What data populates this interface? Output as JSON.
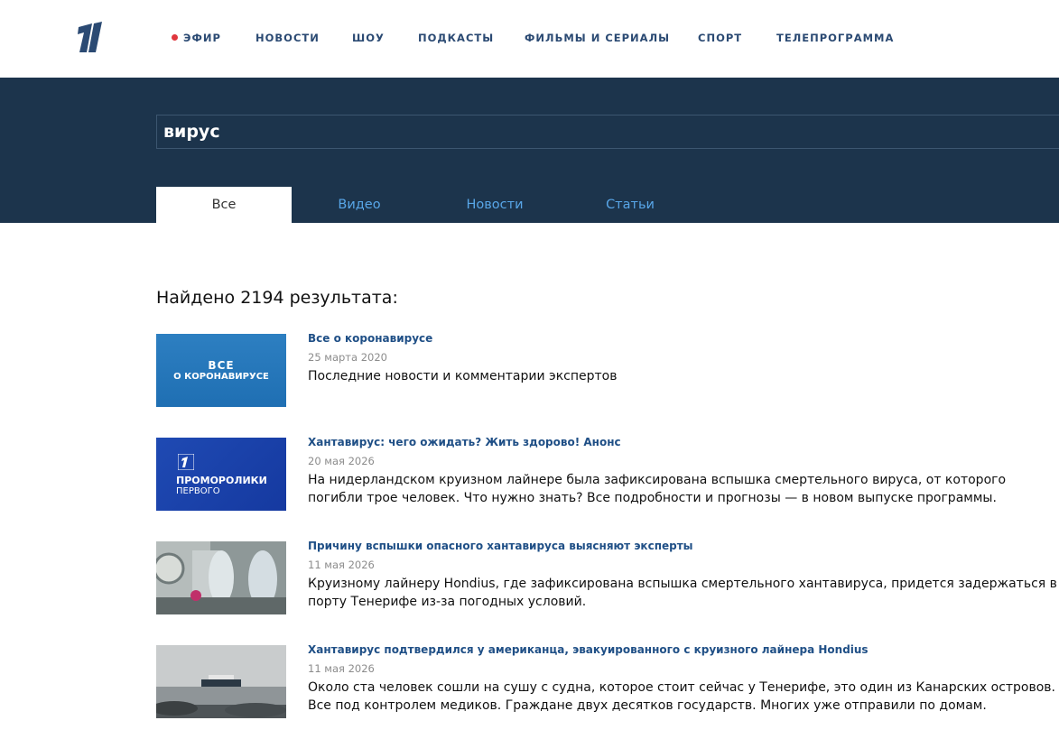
{
  "nav": {
    "items": [
      {
        "label": "ЭФИР",
        "live": true
      },
      {
        "label": "НОВОСТИ"
      },
      {
        "label": "ШОУ"
      },
      {
        "label": "ПОДКАСТЫ"
      },
      {
        "label": "ФИЛЬМЫ И СЕРИАЛЫ"
      },
      {
        "label": "СПОРТ"
      },
      {
        "label": "ТЕЛЕПРОГРАММА"
      }
    ]
  },
  "search": {
    "value": "вирус",
    "tabs": [
      {
        "label": "Все",
        "active": true
      },
      {
        "label": "Видео"
      },
      {
        "label": "Новости"
      },
      {
        "label": "Статьи"
      }
    ]
  },
  "results_count": "Найдено 2194 результата:",
  "results": [
    {
      "title": "Все о коронавирусе",
      "date": "25 марта 2020",
      "description": "Последние новости и комментарии экспертов",
      "thumb_text": [
        "ВСЕ",
        "О КОРОНАВИРУСЕ"
      ]
    },
    {
      "title": "Хантавирус: чего ожидать? Жить здорово! Анонс",
      "date": "20 мая 2026",
      "description": "На нидерландском круизном лайнере была зафиксирована вспышка смертельного вируса, от которого погибли трое человек. Что нужно знать? Все подробности и прогнозы — в новом выпуске программы.",
      "thumb_text": [
        "ПРОМОРОЛИКИ",
        "ПЕРВОГО"
      ]
    },
    {
      "title": "Причину вспышки опасного хантавируса выясняют эксперты",
      "date": "11 мая 2026",
      "description": "Круизному лайнеру Hondius, где зафиксирована вспышка смертельного хантавируса, придется задержаться в порту Тенерифе из-за погодных условий."
    },
    {
      "title": "Хантавирус подтвердился у американца, эвакуированного с круизного лайнера Hondius",
      "date": "11 мая 2026",
      "description": "Около ста человек сошли на сушу с судна, которое стоит сейчас у Тенерифе, это один из Канарских островов. Все под контролем медиков. Граждане двух десятков государств. Многих уже отправили по домам."
    }
  ],
  "colors": {
    "nav_text": "#2b4a73",
    "band": "#1c344c",
    "tab_link": "#58a6e8",
    "result_title": "#1f4f86",
    "live_dot": "#e0363d"
  }
}
